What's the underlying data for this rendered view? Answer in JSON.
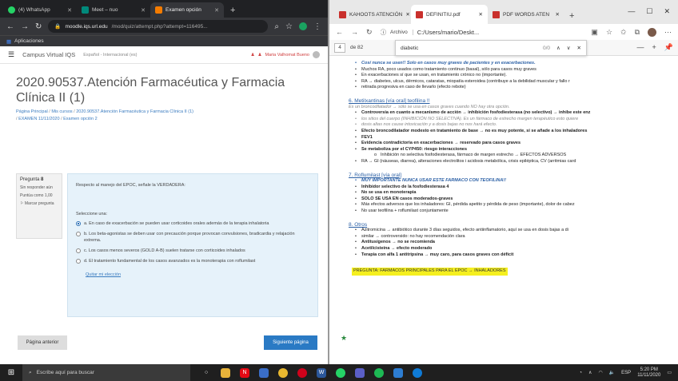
{
  "left_browser": {
    "tabs": [
      {
        "label": "(4) WhatsApp",
        "color": "#25d366"
      },
      {
        "label": "Meet – nuo",
        "color": "#00897b"
      },
      {
        "label": "Examen opción",
        "color": "#f57c00"
      }
    ],
    "url_host": "moodle.iqs.url.edu",
    "url_path": "/mod/quiz/attempt.php?attempt=116495...",
    "bookmarks_label": "Aplicaciones",
    "site_brand": "Campus Virtual IQS",
    "site_lang": "Español - Internacional (es)",
    "user_name": "Maria Valhomat Bueno",
    "course_title": "2020.90537.Atención Farmacéutica y Farmacia Clínica II (1)",
    "breadcrumbs": [
      "Página Principal",
      "Mis cursos",
      "2020.90537.Atención Farmacéutica y Farmacia Clínica II (1)",
      "EXAMEN 11/11/2020",
      "Examen opción 2"
    ],
    "question_info": {
      "label": "Pregunta",
      "number": "8",
      "status": "Sin responder aún",
      "score": "Puntúa como 1,00",
      "flag": "Marcar pregunta"
    },
    "question_text": "Respecto al manejo del EPOC, señale la VERDADERA:",
    "select_label": "Seleccione una:",
    "options": [
      "a. En caso de exacerbación se pueden usar corticoides orales además de la terapia inhalatoria",
      "b. Los beta-agonistas se deben usar con precaución porque provocan convulsiones, bradicardia y relajación extrema.",
      "c. Los casos menos severos (GOLD A-B) suelen tratarse con corticoides inhalados",
      "d. El tratamiento fundamental de los casos avanzados es la monoterapia con roflumilast"
    ],
    "selected_option": 0,
    "clear_label": "Quitar mi elección",
    "prev_label": "Página anterior",
    "next_label": "Siguiente página"
  },
  "right_browser": {
    "tabs": [
      {
        "label": "KAHOOTS ATENCIÓN"
      },
      {
        "label": "DEFINITIU.pdf"
      },
      {
        "label": "PDF WORDS ATEN"
      }
    ],
    "address_pill": "Archivo",
    "address_path": "C:/Users/mario/Deskt...",
    "find_query": "diabetic",
    "find_count": "0/0",
    "page_box": "4",
    "page_total": "de 82",
    "pdf_lines": {
      "l1": "Cosí nunca se usen!! Solo en casos muy graves de pacientes y en exacerbaciones.",
      "l2": "Muchos RA, poco usados como tratamiento continuo (basal), sólo para casos muy graves",
      "l3": "En exacerbaciones sí que se usan, en tratamiento crónico no (importante).",
      "l4": "RA → diabetes, ulcus, dérmicos, cataratas, miopatía esteroidea (contribuye a la debilidad muscular y fallo r",
      "l5": "retirada progresiva en caso de llevarlo (efecto rebote)",
      "h6": "6. Metilxantinas [vía oral] teofilina !!",
      "n6": "Es un broncodilatador → sólo se usa en casos graves cuando NO hay otra opción.",
      "l6a": "Controversia en cuanto a mecanismo de acción → inhibición fosfodiesterasa (no selectivo) → inhibe este enz",
      "l6b": "los sitios del cuerpo (INHIBICIÓN NO SELECTIVA). Es un fármaco de estrecho margen terapéutico esto quiere",
      "l6c": "dosis altas nos cause intoxicación y a dosis bajas no nos hará efecto.",
      "l6d": "Efecto broncodilatador modesto en tratamiento de base → no es muy potente, si se añade a los inhaladores",
      "l6e": "FEV1",
      "l6f": "Evidencia contradictoria en exacerbaciones → reservado para casos graves",
      "l6g": "Se metaboliza por el CYP450: riesgo interacciones",
      "l6h": "Inhibición no selectiva fosfodiesterasa, fármaco de margen estrecho → EFECTOS ADVERSOS",
      "l6i": "RA → GI (náuseas, diarrea), alteraciones electrolitos i acidosis metabólica, crisis epiléptica, CV (arritmias card",
      "h7": "7. Roflumilast [vía oral]",
      "l7a": "MUY IMPORTANTE NUNCA USAR ESTE FARMACO CON TEOFILINA!!",
      "l7b": "Inhibidor selectivo de la fosfodiesterasa 4",
      "l7c": "No se usa en monoterapia",
      "l7d": "SOLO SE USA EN casos moderados-graves",
      "l7e": "Más efectos adversos que los inhaladores: GI, pérdida apetito y pérdida de peso (importante), dolor de cabez",
      "l7f": "No usar teofilina + roflumilast conjuntamente",
      "h8": "8. Otros",
      "l8a": "Azitromicina → antibiótico durante 3 días seguidos, efecto antiinflamatorio, aquí se usa en dosis bajas a di",
      "l8b": "similar → controversido: no hay recomendación clara",
      "l8c": "Antitusígenos → no se recomienda",
      "l8d": "Acetilcisteína → efecto moderado",
      "l8e": "Terapia con alfa 1 antitripsina → muy caro, para casos graves con déficit",
      "highlight": "PREGUNTA: FARMACOS PRINCIPALES PARA EL EPOC → INHALADORES"
    }
  },
  "taskbar": {
    "search_placeholder": "Escribe aquí para buscar",
    "time": "5:20 PM",
    "date": "11/11/2020",
    "lang": "ESP"
  }
}
